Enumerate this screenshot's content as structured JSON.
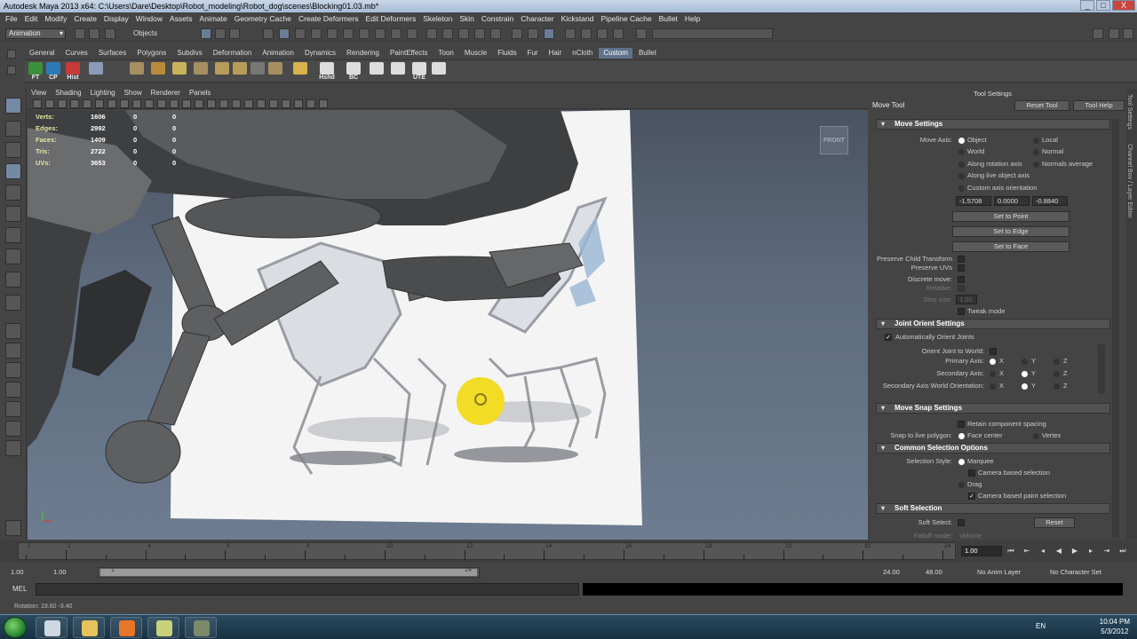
{
  "window": {
    "title": "Autodesk Maya 2013 x64: C:\\Users\\Dare\\Desktop\\Robot_modeling\\Robot_dog\\scenes\\Blocking01.03.mb*",
    "controls": [
      "_",
      "□",
      "X"
    ]
  },
  "menu": [
    "File",
    "Edit",
    "Modify",
    "Create",
    "Display",
    "Window",
    "Assets",
    "Animate",
    "Geometry Cache",
    "Create Deformers",
    "Edit Deformers",
    "Skeleton",
    "Skin",
    "Constrain",
    "Character",
    "Kickstand",
    "Pipeline Cache",
    "Bullet",
    "Help"
  ],
  "status_line": {
    "mode": "Animation",
    "selection_mode": "Objects"
  },
  "shelf": {
    "tabs": [
      "General",
      "Curves",
      "Surfaces",
      "Polygons",
      "Subdivs",
      "Deformation",
      "Animation",
      "Dynamics",
      "Rendering",
      "PaintEffects",
      "Toon",
      "Muscle",
      "Fluids",
      "Fur",
      "Hair",
      "nCloth",
      "Custom",
      "Bullet"
    ],
    "active_tab": "Custom",
    "icons": [
      {
        "label": "FT",
        "icon": "freeze-transform-icon",
        "color": "#3a8f3a"
      },
      {
        "label": "CP",
        "icon": "center-pivot-icon",
        "color": "#2e7ab8"
      },
      {
        "label": "Hist",
        "icon": "delete-history-icon",
        "color": "#c63a3a"
      },
      {
        "label": "",
        "icon": "cone-icon",
        "color": "#8a9ab8"
      },
      {
        "label": "",
        "icon": "poly-cube-icon",
        "color": "#a58e62"
      },
      {
        "label": "",
        "icon": "extrude-icon",
        "color": "#b88a3a"
      },
      {
        "label": "",
        "icon": "sphere-icon",
        "color": "#c9b35a"
      },
      {
        "label": "",
        "icon": "poly-cylinder-icon",
        "color": "#a58e62"
      },
      {
        "label": "",
        "icon": "plane-icon",
        "color": "#b89c5a"
      },
      {
        "label": "",
        "icon": "cube-icon",
        "color": "#b89c5a"
      },
      {
        "label": "",
        "icon": "soccer-ball-icon",
        "color": "#777777"
      },
      {
        "label": "",
        "icon": "torus-icon",
        "color": "#a58e62"
      },
      {
        "label": "",
        "icon": "brush-icon",
        "color": "#d9b24c"
      },
      {
        "label": "Hshd",
        "icon": "hypershade-icon",
        "color": "#dddddd"
      },
      {
        "label": "BC",
        "icon": "bonus-camera-icon",
        "color": "#dddddd"
      },
      {
        "label": "",
        "icon": "circle-icon",
        "color": "#dddddd"
      },
      {
        "label": "",
        "icon": "curve-icon",
        "color": "#dddddd"
      },
      {
        "label": "UTE",
        "icon": "uv-texture-editor-icon",
        "color": "#dddddd"
      },
      {
        "label": "",
        "icon": "grid-icon",
        "color": "#dddddd"
      }
    ]
  },
  "viewport": {
    "menu": [
      "View",
      "Shading",
      "Lighting",
      "Show",
      "Renderer",
      "Panels"
    ],
    "hud": [
      {
        "label": "Verts:",
        "v1": "1606",
        "v2": "0",
        "v3": "0"
      },
      {
        "label": "Edges:",
        "v1": "2992",
        "v2": "0",
        "v3": "0"
      },
      {
        "label": "Faces:",
        "v1": "1409",
        "v2": "0",
        "v3": "0"
      },
      {
        "label": "Tris:",
        "v1": "2722",
        "v2": "0",
        "v3": "0"
      },
      {
        "label": "UVs:",
        "v1": "3653",
        "v2": "0",
        "v3": "0"
      }
    ],
    "viewcube": "FRONT"
  },
  "tool_settings": {
    "panel_title": "Tool Settings",
    "tool_name": "Move Tool",
    "reset_tool": "Reset Tool",
    "tool_help": "Tool Help",
    "move_settings": {
      "header": "Move Settings",
      "move_axis_label": "Move Axis:",
      "options": [
        "Object",
        "Local",
        "World",
        "Normal",
        "Along rotation axis",
        "Normals average",
        "Along live object axis",
        "Custom axis orientation"
      ],
      "selected": "Object",
      "values": [
        "-1.5708",
        "0.0000",
        "-0.8840"
      ],
      "set_to_point": "Set to Point",
      "set_to_edge": "Set to Edge",
      "set_to_face": "Set to Face",
      "preserve_child": "Preserve Child Transform",
      "preserve_uvs": "Preserve UVs",
      "discrete_move": "Discrete move:",
      "relative": "Relative:",
      "step_size": "Step size:",
      "step_value": "1.00",
      "tweak_mode": "Tweak mode"
    },
    "joint_orient": {
      "header": "Joint Orient Settings",
      "auto_orient": "Automatically Orient Joints",
      "orient_to_world": "Orient Joint to World:",
      "primary_axis": "Primary Axis:",
      "secondary_axis": "Secondary Axis:",
      "secondary_world": "Secondary Axis World Orientation:",
      "x": "X",
      "y": "Y",
      "z": "Z"
    },
    "move_snap": {
      "header": "Move Snap Settings",
      "retain": "Retain component spacing",
      "snap_live": "Snap to live polygon:",
      "face_center": "Face center",
      "vertex": "Vertex"
    },
    "common_selection": {
      "header": "Common Selection Options",
      "style_label": "Selection Style:",
      "marquee": "Marquee",
      "camera_based": "Camera based selection",
      "drag": "Drag",
      "camera_paint": "Camera based paint selection"
    },
    "soft_selection": {
      "header": "Soft Selection",
      "soft_select": "Soft Select:",
      "reset": "Reset",
      "falloff_mode": "Falloff mode:",
      "falloff_value": "Volume"
    },
    "side_tabs": [
      "Tool Settings",
      "Channel Box / Layer Editor"
    ]
  },
  "timeline": {
    "ticks": [
      "1",
      "2",
      "4",
      "6",
      "8",
      "10",
      "12",
      "14",
      "16",
      "18",
      "20",
      "22",
      "24"
    ],
    "current_frame": "1.00",
    "range": {
      "start": "1.00",
      "inner_start": "1.00",
      "handle_start": "1",
      "handle_end": "24",
      "end": "24.00",
      "outer_end": "48.00"
    },
    "anim_layer": "No Anim Layer",
    "character_set": "No Character Set"
  },
  "mel": {
    "label": "MEL"
  },
  "help_line": "Rotation:  19.60    -3.40",
  "taskbar": {
    "language": "EN",
    "time": "10:04 PM",
    "date": "5/3/2012",
    "apps": [
      {
        "icon": "maya-icon",
        "color": "#cfd7e0"
      },
      {
        "icon": "explorer-icon",
        "color": "#e8c25a"
      },
      {
        "icon": "firefox-icon",
        "color": "#e8762a"
      },
      {
        "icon": "folder-icon",
        "color": "#c9d27a"
      },
      {
        "icon": "tool-icon",
        "color": "#7a8a6a"
      }
    ]
  }
}
